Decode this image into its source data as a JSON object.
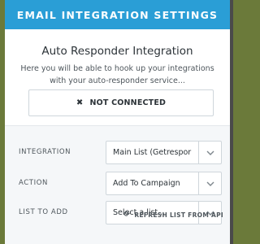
{
  "header": {
    "title": "EMAIL INTEGRATION SETTINGS"
  },
  "intro": {
    "title": "Auto Responder Integration",
    "description": "Here you will be able to hook up your integrations with your auto-responder service..."
  },
  "status": {
    "label": "NOT CONNECTED",
    "icon": "close-icon"
  },
  "form": {
    "integration": {
      "label": "INTEGRATION",
      "value": "Main List (Getrespor"
    },
    "action": {
      "label": "ACTION",
      "value": "Add To Campaign"
    },
    "list": {
      "label": "LIST TO ADD",
      "value": "Select a list..."
    },
    "refresh_label": "REFRESH LIST FROM API"
  },
  "colors": {
    "accent": "#2a9ed6",
    "form_bg": "#f5f7f9",
    "border": "#cfd6db"
  }
}
